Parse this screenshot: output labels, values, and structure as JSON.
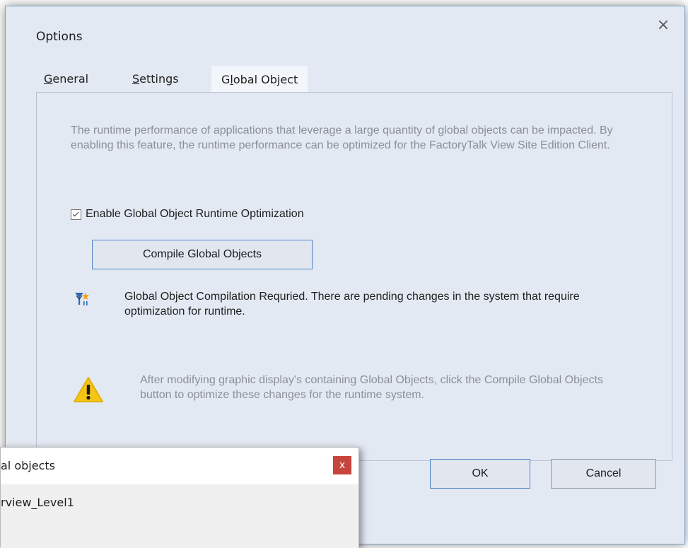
{
  "dialog": {
    "title": "Options",
    "close_glyph": "×",
    "tabs": [
      {
        "pre": "",
        "ul": "G",
        "post": "eneral",
        "active": false
      },
      {
        "pre": "",
        "ul": "S",
        "post": "ettings",
        "active": false
      },
      {
        "pre": "G",
        "ul": "l",
        "post": "obal Object",
        "active": true
      }
    ],
    "description": "The runtime performance of applications that leverage a large quantity of global objects can be impacted. By enabling this feature, the runtime performance can be optimized for the FactoryTalk View Site Edition Client.",
    "checkbox_label": "Enable Global Object Runtime Optimization",
    "checkbox_checked": true,
    "compile_button": "Compile Global Objects",
    "info_text": "Global Object Compilation Requried. There are pending changes in the system that require optimization for runtime.",
    "warning_text": "After modifying graphic display's containing Global Objects, click the Compile Global Objects button to optimize these changes for the runtime system.",
    "ok_button": "OK",
    "cancel_button": "Cancel",
    "icons": {
      "info": "pending-changes-icon",
      "warning": "warning-icon",
      "close": "close-icon"
    }
  },
  "subwindow": {
    "title": "al objects",
    "close_glyph": "x",
    "item": "rview_Level1"
  },
  "colors": {
    "dialog_bg": "#e3e9f3",
    "accent_border": "#4e84c4",
    "warning_yellow": "#f5c516",
    "close_red": "#c7443c"
  }
}
